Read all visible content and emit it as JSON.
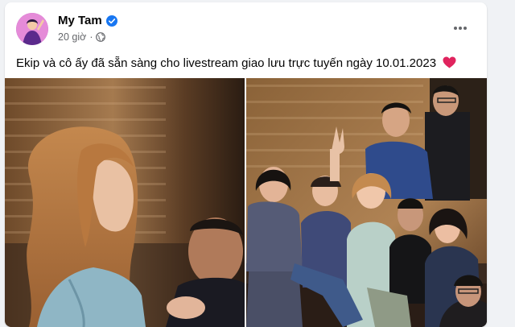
{
  "post": {
    "author_name": "My Tam",
    "time": "20 giờ",
    "separator": "·",
    "caption": "Ekip và cô ấy đã sẵn sàng cho livestream giao lưu trực tuyến ngày 10.01.2023",
    "icons": {
      "verified": "verified-badge-icon",
      "audience": "globe-icon",
      "more": "more-options-icon",
      "emoji": "red-heart-icon"
    },
    "colors": {
      "verified_blue": "#1877f2",
      "heart_red": "#e0245e",
      "meta_gray": "#65676b"
    }
  }
}
